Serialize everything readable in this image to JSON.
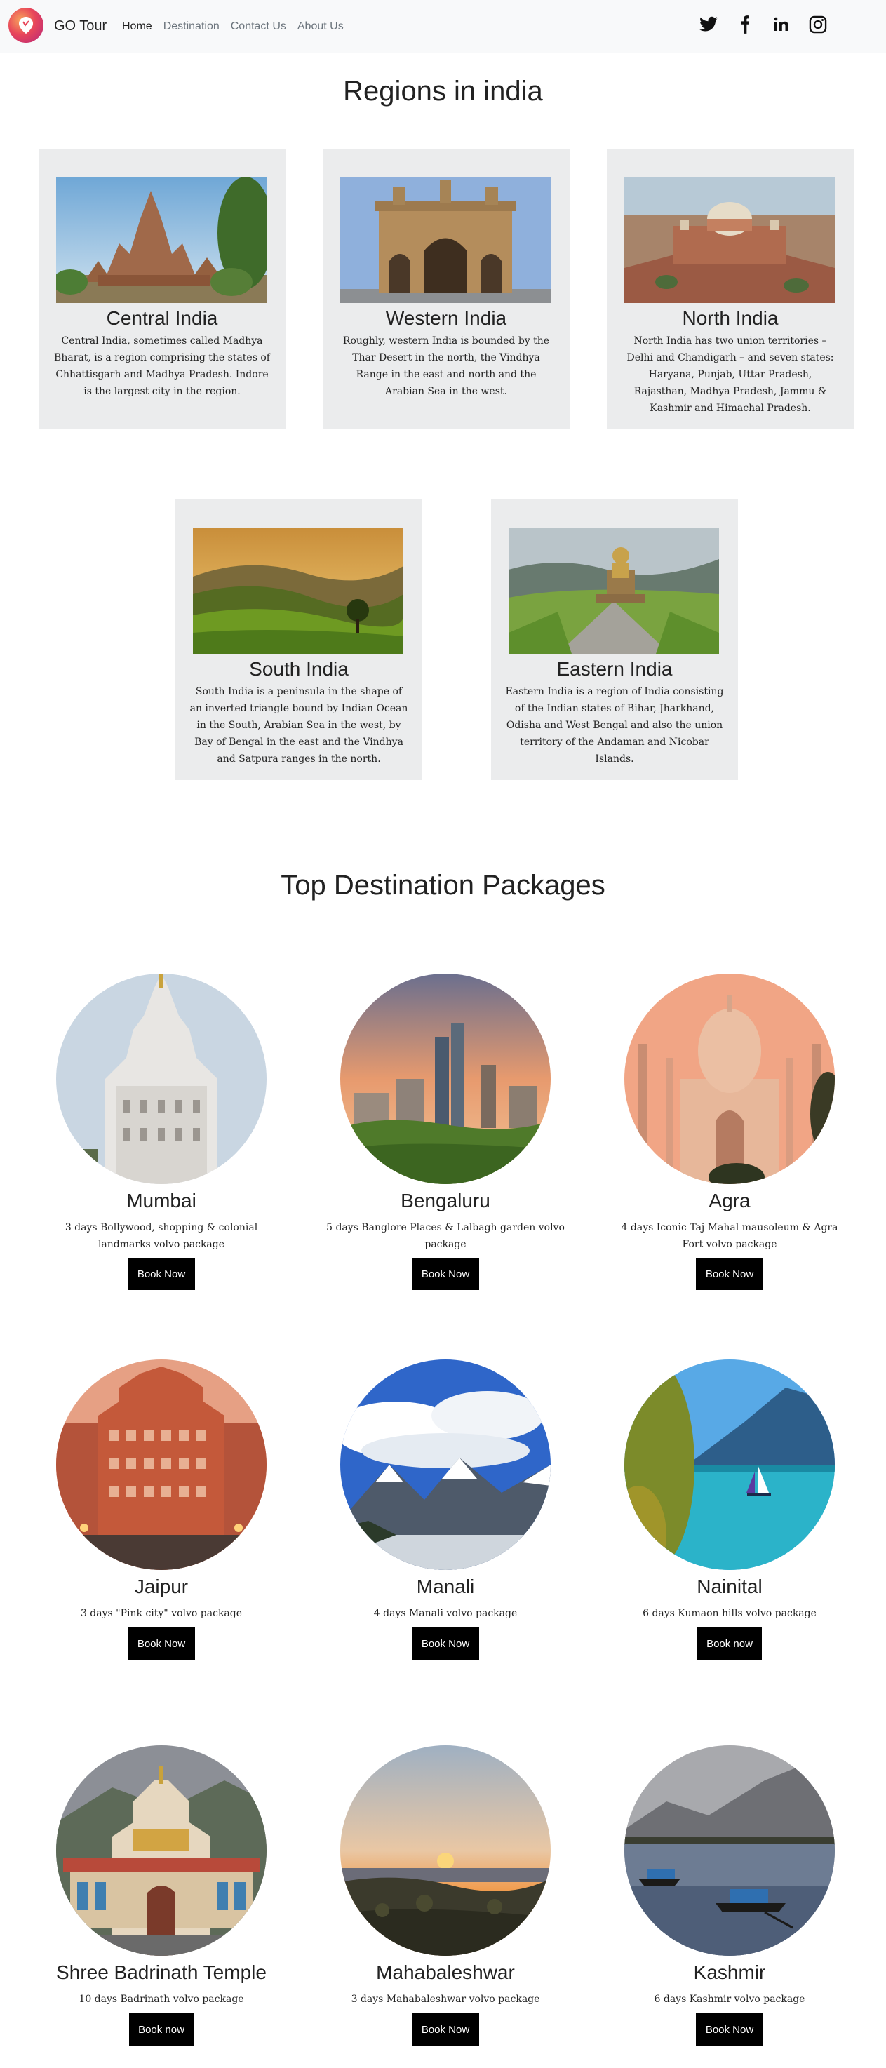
{
  "navbar": {
    "brand": "GO Tour",
    "links": [
      "Home",
      "Destination",
      "Contact Us",
      "About Us"
    ],
    "icons": [
      "twitter-icon",
      "facebook-icon",
      "linkedin-icon",
      "instagram-icon"
    ]
  },
  "regions": {
    "title": "Regions in india",
    "cards": [
      {
        "name": "Central India",
        "desc": "Central India, sometimes called Madhya Bharat, is a region comprising the states of Chhattisgarh and Madhya Pradesh. Indore is the largest city in the region."
      },
      {
        "name": "Western India",
        "desc": "Roughly, western India is bounded by the Thar Desert in the north, the Vindhya Range in the east and north and the Arabian Sea in the west."
      },
      {
        "name": "North India",
        "desc": "North India has two union territories – Delhi and Chandigarh – and seven states: Haryana, Punjab, Uttar Pradesh, Rajasthan, Madhya Pradesh, Jammu & Kashmir and Himachal Pradesh."
      },
      {
        "name": "South India",
        "desc": "South India is a peninsula in the shape of an inverted triangle bound by Indian Ocean in the South, Arabian Sea in the west, by Bay of Bengal in the east and the Vindhya and Satpura ranges in the north."
      },
      {
        "name": "Eastern India",
        "desc": "Eastern India is a region of India consisting of the Indian states of Bihar, Jharkhand, Odisha and West Bengal and also the union territory of the Andaman and Nicobar Islands."
      }
    ]
  },
  "packages": {
    "title": "Top Destination Packages",
    "items": [
      {
        "name": "Mumbai",
        "desc": "3 days Bollywood, shopping & colonial landmarks volvo package",
        "button": "Book Now"
      },
      {
        "name": "Bengaluru",
        "desc": "5 days Banglore Places & Lalbagh garden volvo package",
        "button": "Book Now"
      },
      {
        "name": "Agra",
        "desc": "4 days Iconic Taj Mahal mausoleum & Agra Fort volvo package",
        "button": "Book Now"
      },
      {
        "name": "Jaipur",
        "desc": "3 days \"Pink city\" volvo package",
        "button": "Book Now"
      },
      {
        "name": "Manali",
        "desc": "4 days Manali volvo package",
        "button": "Book Now"
      },
      {
        "name": "Nainital",
        "desc": "6 days Kumaon hills volvo package",
        "button": "Book now"
      },
      {
        "name": "Shree Badrinath Temple",
        "desc": "10 days Badrinath volvo package",
        "button": "Book now"
      },
      {
        "name": "Mahabaleshwar",
        "desc": "3 days Mahabaleshwar volvo package",
        "button": "Book Now"
      },
      {
        "name": "Kashmir",
        "desc": "6 days Kashmir volvo package",
        "button": "Book Now"
      }
    ]
  }
}
